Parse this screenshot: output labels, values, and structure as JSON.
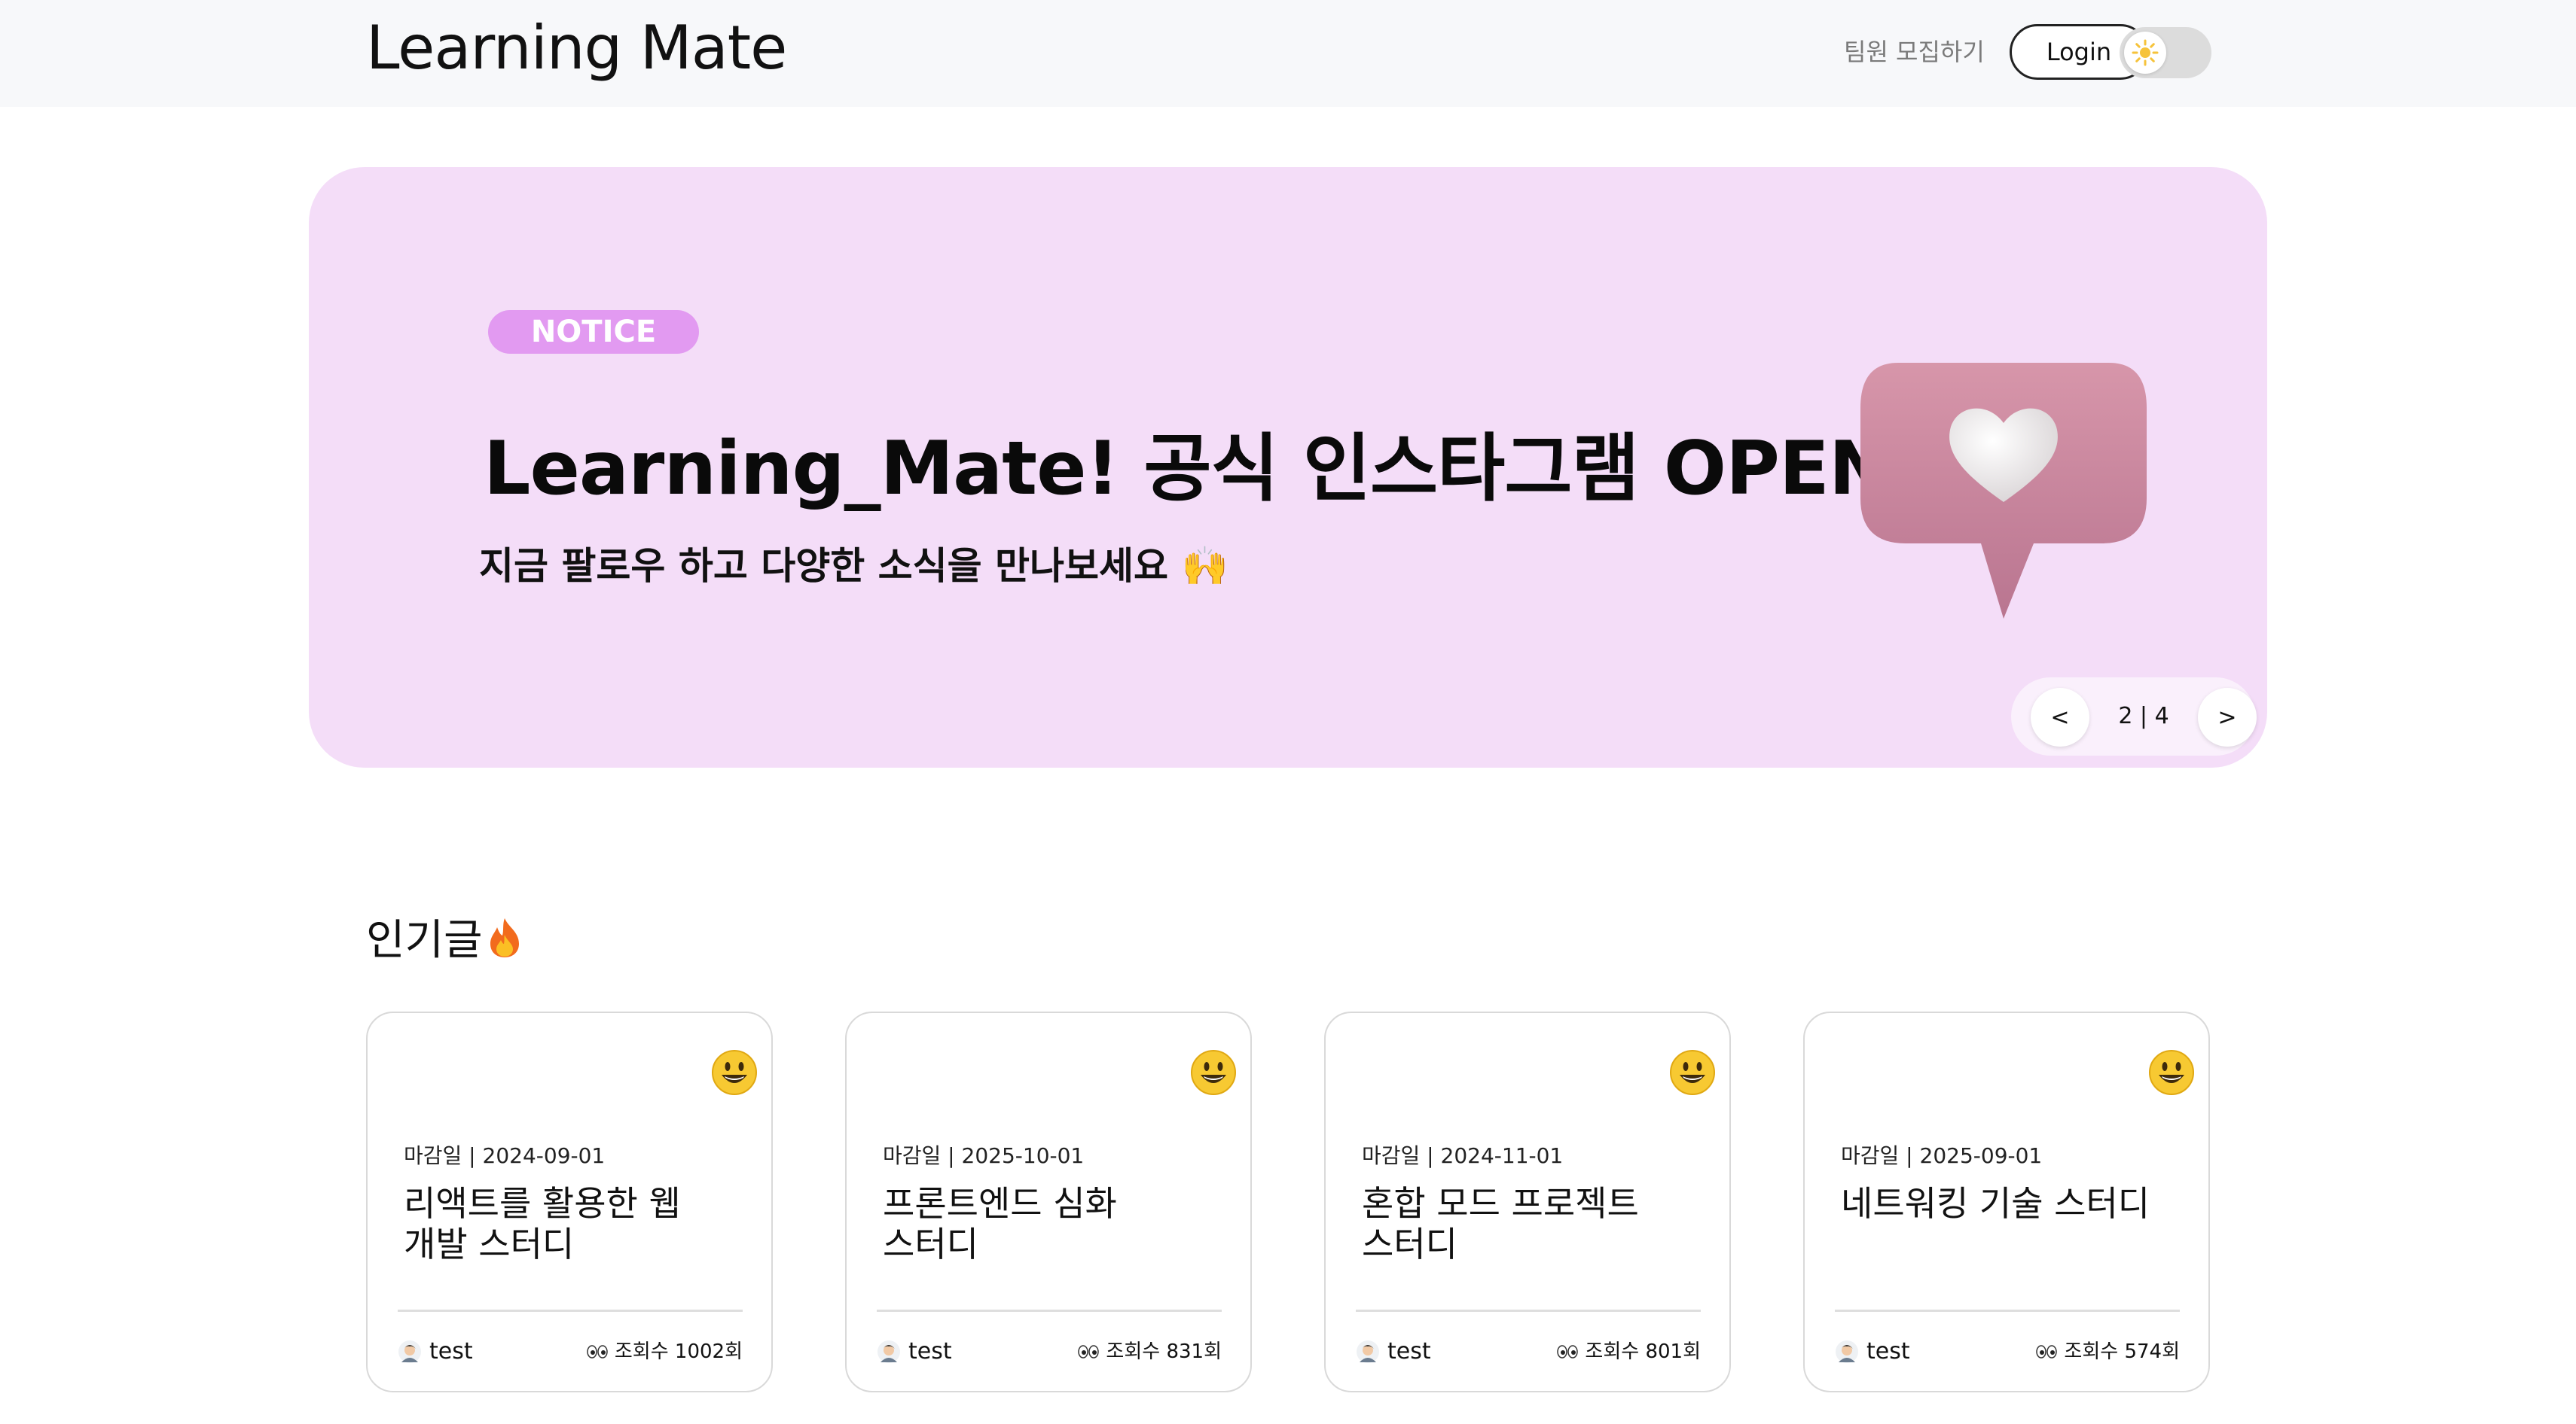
{
  "header": {
    "logo": "Learning Mate",
    "recruit_link": "팀원 모집하기",
    "login_label": "Login",
    "theme_toggle_icon": "sun-icon"
  },
  "banner": {
    "badge": "NOTICE",
    "title": "Learning_Mate! 공식 인스타그램 OPEN!",
    "subtitle": "지금 팔로우 하고 다양한 소식을 만나보세요 🙌",
    "illustration": "heart-speech-bubble",
    "background": "#f4ddf8",
    "badge_color": "#e29af1",
    "pager": {
      "prev_label": "<",
      "next_label": ">",
      "count": "2 | 4"
    }
  },
  "popular": {
    "title": "인기글",
    "title_icon": "fire-icon",
    "cards": [
      {
        "deadline": "마감일 | 2024-09-01",
        "title": "리액트를 활용한 웹 개발 스터디",
        "author": "test",
        "views": "조회수 1002회",
        "emoji": "smiley-icon"
      },
      {
        "deadline": "마감일 | 2025-10-01",
        "title": "프론트엔드 심화 스터디",
        "author": "test",
        "views": "조회수 831회",
        "emoji": "smiley-icon"
      },
      {
        "deadline": "마감일 | 2024-11-01",
        "title": "혼합 모드 프로젝트 스터디",
        "author": "test",
        "views": "조회수 801회",
        "emoji": "smiley-icon"
      },
      {
        "deadline": "마감일 | 2025-09-01",
        "title": "네트워킹 기술 스터디",
        "author": "test",
        "views": "조회수 574회",
        "emoji": "smiley-icon"
      }
    ]
  }
}
